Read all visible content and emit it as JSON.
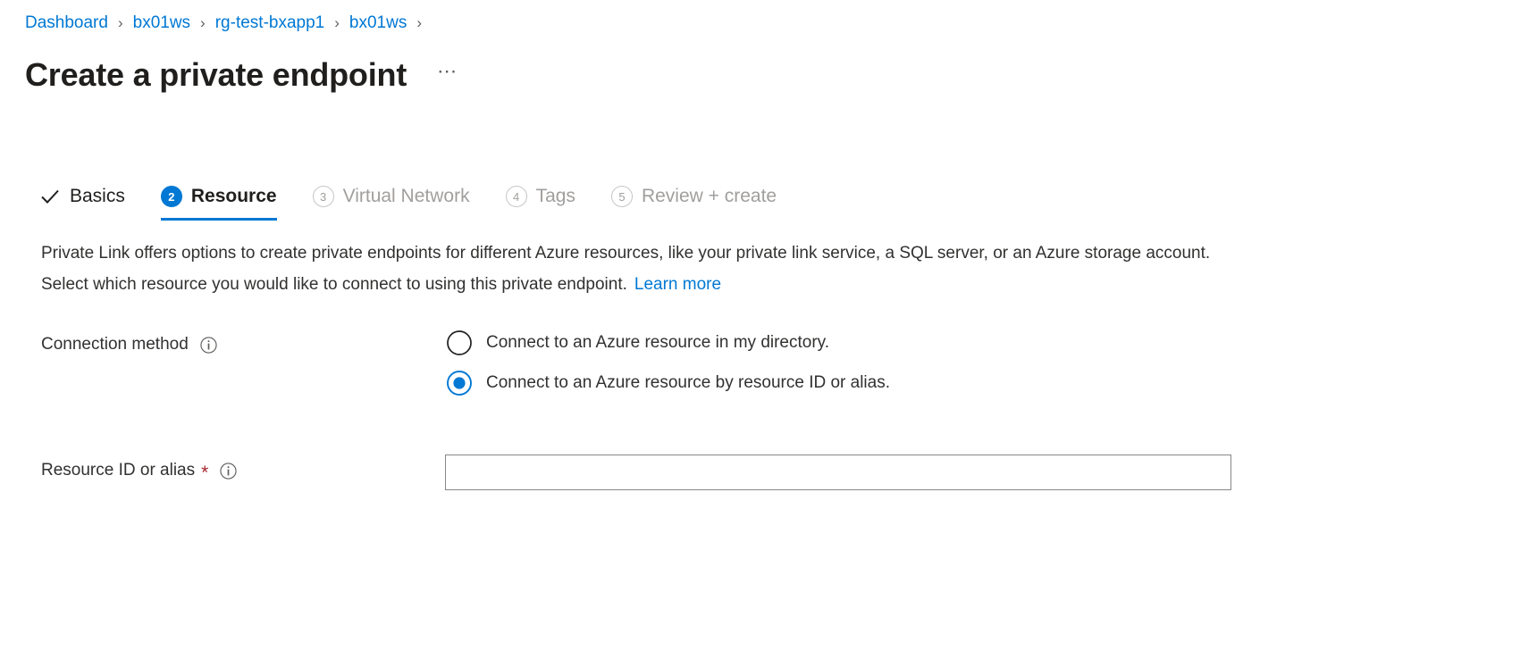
{
  "breadcrumb": {
    "separator": "›",
    "items": [
      {
        "label": "Dashboard"
      },
      {
        "label": "bx01ws"
      },
      {
        "label": "rg-test-bxapp1"
      },
      {
        "label": "bx01ws"
      }
    ]
  },
  "header": {
    "title": "Create a private endpoint",
    "more_label": "⋯"
  },
  "tabs": [
    {
      "label": "Basics",
      "step": "✓",
      "state": "done"
    },
    {
      "label": "Resource",
      "step": "2",
      "state": "active"
    },
    {
      "label": "Virtual Network",
      "step": "3",
      "state": "pending"
    },
    {
      "label": "Tags",
      "step": "4",
      "state": "pending"
    },
    {
      "label": "Review + create",
      "step": "5",
      "state": "pending"
    }
  ],
  "description": {
    "text": "Private Link offers options to create private endpoints for different Azure resources, like your private link service, a SQL server, or an Azure storage account. Select which resource you would like to connect to using this private endpoint.",
    "link_label": "Learn more"
  },
  "form": {
    "connection_method": {
      "label": "Connection method",
      "options": [
        {
          "label": "Connect to an Azure resource in my directory.",
          "selected": false
        },
        {
          "label": "Connect to an Azure resource by resource ID or alias.",
          "selected": true
        }
      ]
    },
    "resource_id": {
      "label": "Resource ID or alias",
      "required_marker": "*",
      "value": "",
      "placeholder": ""
    }
  },
  "colors": {
    "accent": "#0078d4",
    "link": "#0078d4",
    "text": "#323130",
    "muted": "#a19f9d",
    "required": "#a4262c",
    "border": "#8a8886"
  }
}
